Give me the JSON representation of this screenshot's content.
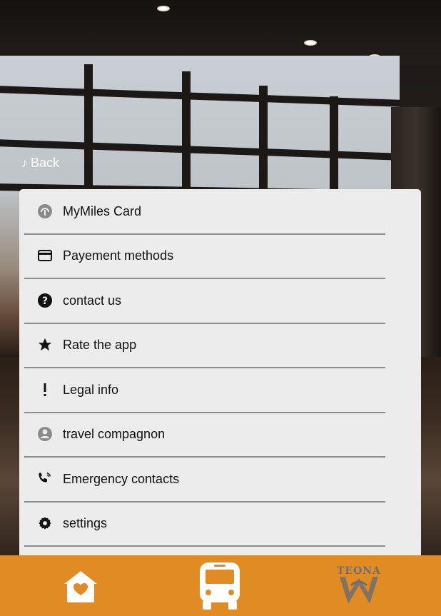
{
  "nav": {
    "back_label": "Back"
  },
  "menu": {
    "items": [
      {
        "label": "MyMiles Card",
        "icon": "card-circle-icon"
      },
      {
        "label": "Payement methods",
        "icon": "credit-card-icon"
      },
      {
        "label": "contact us",
        "icon": "help-circle-icon"
      },
      {
        "label": "Rate the app",
        "icon": "star-icon"
      },
      {
        "label": "Legal info",
        "icon": "exclamation-icon"
      },
      {
        "label": "travel compagnon",
        "icon": "person-circle-icon"
      },
      {
        "label": "Emergency contacts",
        "icon": "phone-ringing-icon"
      },
      {
        "label": "settings",
        "icon": "gear-icon"
      }
    ]
  },
  "bottom_nav": {
    "tabs": [
      {
        "icon": "home-heart-icon"
      },
      {
        "icon": "bus-icon"
      },
      {
        "icon": "teona-logo-icon",
        "logo_text": "TEONA"
      }
    ]
  },
  "colors": {
    "bottom_bar": "#e18b25",
    "panel": "#ececec",
    "divider": "#8c8c8c",
    "icon_gray": "#8a8a8a"
  }
}
